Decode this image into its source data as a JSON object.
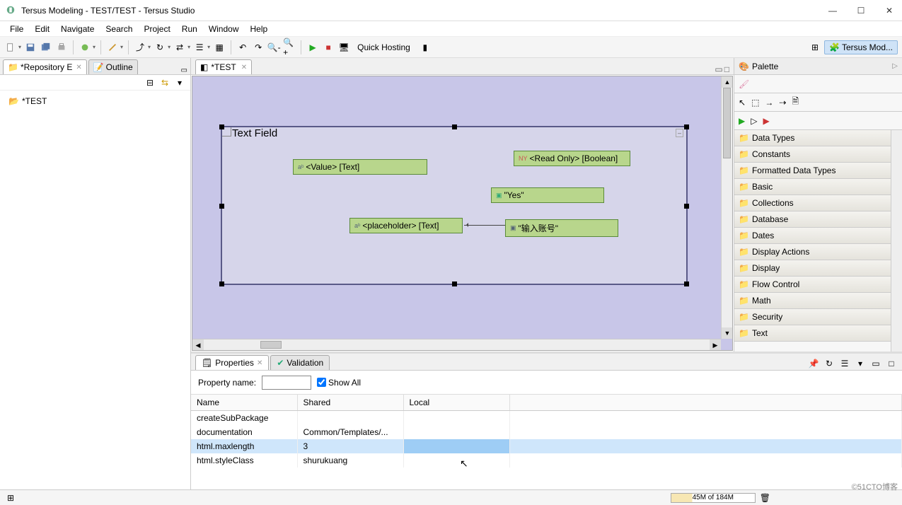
{
  "window": {
    "title": "Tersus Modeling - TEST/TEST - Tersus Studio"
  },
  "menu": {
    "file": "File",
    "edit": "Edit",
    "navigate": "Navigate",
    "search": "Search",
    "project": "Project",
    "run": "Run",
    "window": "Window",
    "help": "Help"
  },
  "toolbar": {
    "quick_hosting": "Quick Hosting"
  },
  "perspective": {
    "label": "Tersus Mod..."
  },
  "left": {
    "tab_repo": "*Repository E",
    "tab_outline": "Outline",
    "tree_root": "*TEST"
  },
  "editor": {
    "tab": "*TEST"
  },
  "canvas": {
    "title": "Text Field",
    "n1": "<Value> [Text]",
    "n2": "<Read Only> [Boolean]",
    "n3": "\"Yes\"",
    "n4": "<placeholder> [Text]",
    "n5": "\"输入账号\""
  },
  "palette": {
    "title": "Palette",
    "cats": [
      "Data Types",
      "Constants",
      "Formatted Data Types",
      "Basic",
      "Collections",
      "Database",
      "Dates",
      "Display Actions",
      "Display",
      "Flow Control",
      "Math",
      "Security",
      "Text"
    ]
  },
  "bottom": {
    "tab_props": "Properties",
    "tab_valid": "Validation",
    "filter_label": "Property name:",
    "show_all": "Show All",
    "col_name": "Name",
    "col_shared": "Shared",
    "col_local": "Local",
    "rows": [
      {
        "name": "createSubPackage",
        "shared": "",
        "local": ""
      },
      {
        "name": "documentation",
        "shared": "Common/Templates/...",
        "local": ""
      },
      {
        "name": "html.maxlength",
        "shared": "3",
        "local": ""
      },
      {
        "name": "html.styleClass",
        "shared": "shurukuang",
        "local": ""
      }
    ]
  },
  "status": {
    "mem": "45M of 184M"
  },
  "watermark": "©51CTO博客"
}
